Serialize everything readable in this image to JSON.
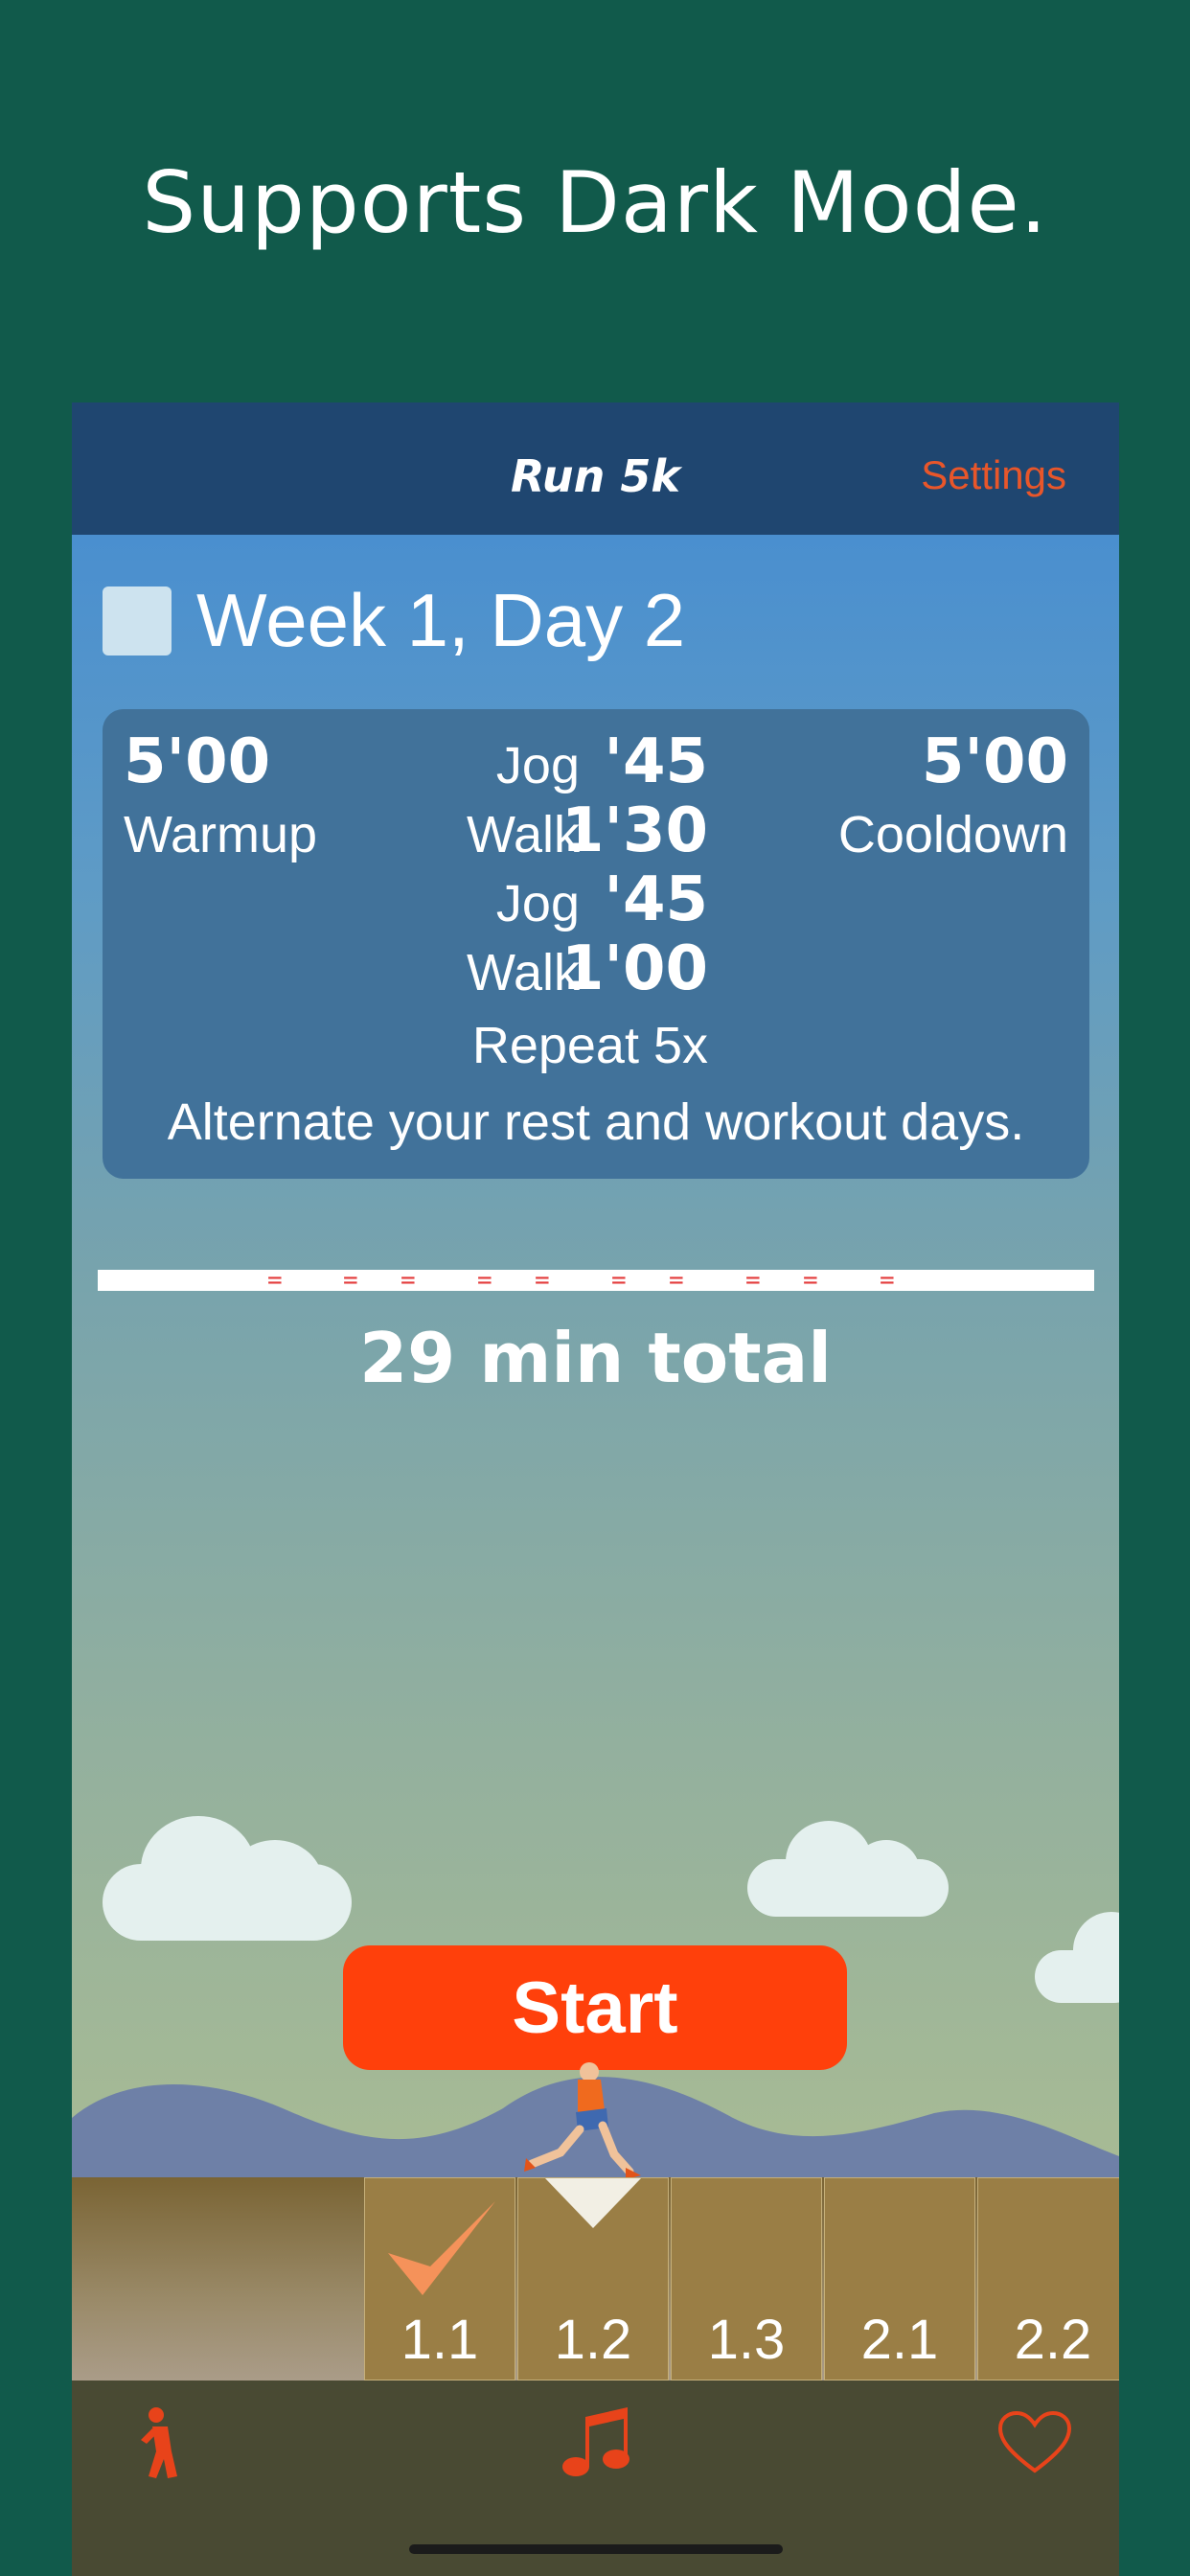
{
  "headline": "Supports Dark Mode.",
  "nav": {
    "title": "Run 5k",
    "settings": "Settings"
  },
  "day": {
    "title": "Week 1, Day 2",
    "completed": false
  },
  "plan": {
    "warmup_time": "5'00",
    "warmup_label": "Warmup",
    "cooldown_time": "5'00",
    "cooldown_label": "Cooldown",
    "intervals": [
      {
        "label": "Jog",
        "time": "'45"
      },
      {
        "label": "Walk",
        "time": "1'30"
      },
      {
        "label": "Jog",
        "time": "'45"
      },
      {
        "label": "Walk",
        "time": "1'00"
      }
    ],
    "repeat": "Repeat 5x",
    "tip": "Alternate your rest and workout days."
  },
  "total": "29 min total",
  "start_label": "Start",
  "workouts": [
    {
      "label": "1.1",
      "completed": true
    },
    {
      "label": "1.2",
      "current": true
    },
    {
      "label": "1.3"
    },
    {
      "label": "2.1"
    },
    {
      "label": "2.2"
    }
  ],
  "tabs": [
    {
      "icon": "stretch-figure-icon"
    },
    {
      "icon": "music-note-icon"
    },
    {
      "icon": "heart-icon"
    }
  ],
  "colors": {
    "accent": "#ff400b",
    "background": "#115a4b",
    "nav": "#1f4670"
  }
}
